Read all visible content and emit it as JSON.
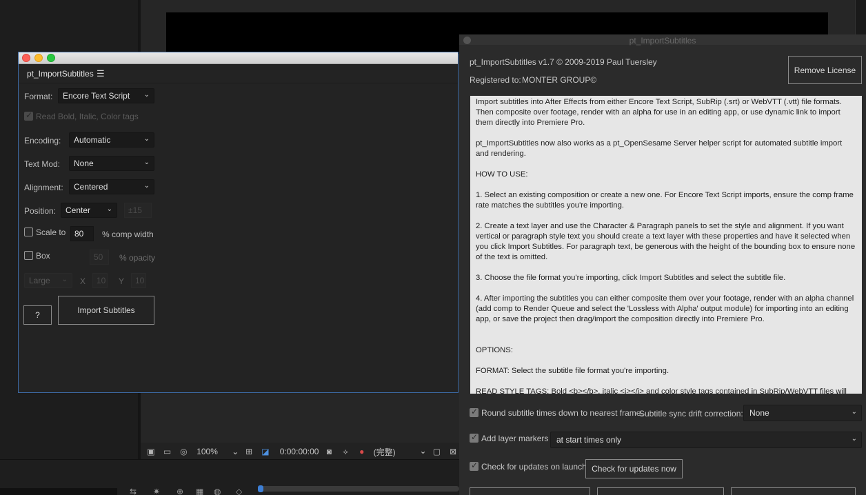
{
  "left_window": {
    "tab_label": "pt_ImportSubtitles",
    "format_label": "Format:",
    "format_value": "Encore Text Script",
    "read_tags_label": "Read Bold, Italic, Color tags",
    "encoding_label": "Encoding:",
    "encoding_value": "Automatic",
    "textmod_label": "Text Mod:",
    "textmod_value": "None",
    "alignment_label": "Alignment:",
    "alignment_value": "Centered",
    "position_label": "Position:",
    "position_value": "Center",
    "position_extra": "±15",
    "scale_label": "Scale to",
    "scale_value": "80",
    "scale_unit": "%  comp width",
    "box_label": "Box",
    "box_opacity_value": "50",
    "box_opacity_unit": "%  opacity",
    "size_value": "Large",
    "x_label": "X",
    "x_value": "10",
    "y_label": "Y",
    "y_value": "10",
    "help_button": "?",
    "import_button": "Import Subtitles"
  },
  "right_window": {
    "title": "pt_ImportSubtitles",
    "version_line": "pt_ImportSubtitles v1.7 © 2009-2019 Paul Tuersley",
    "registered_label": "Registered to:",
    "registered_value": "MONTER GROUP©",
    "remove_license_button": "Remove License",
    "help_paragraphs": [
      "Import subtitles into After Effects from either Encore Text Script, SubRip (.srt) or WebVTT (.vtt) file formats. Then composite over footage, render with an alpha for use in an editing app, or use dynamic link to import them directly into Premiere Pro.",
      "pt_ImportSubtitles now also works as a pt_OpenSesame Server helper script for automated subtitle import and rendering.",
      "HOW TO USE:",
      "1. Select an existing composition or create a new one. For Encore Text Script imports, ensure the comp frame rate matches the subtitles you're importing.",
      "2. Create a text layer and use the Character & Paragraph panels to set the style and alignment. If you want vertical or paragraph style text you should create a text layer with these properties and have it selected when you click Import Subtitles. For paragraph text, be generous with the height of the bounding box to ensure none of the text is omitted.",
      "3. Choose the file format you're importing, click Import Subtitles and select the subtitle file.",
      "4. After importing the subtitles you can either composite them over your footage, render with an alpha channel (add comp to Render Queue and select the 'Lossless with Alpha' output module) for importing into an editing app, or save the project then drag/import the composition directly into Premiere Pro.",
      "OPTIONS:",
      "FORMAT: Select the subtitle file format you're importing.",
      "READ STYLE TAGS: Bold <b></b>, italic <i></i> and color style tags contained in SubRip/WebVTT files will be"
    ],
    "round_label": "Round subtitle times down to nearest frame.",
    "drift_label": "Subtitle sync drift correction:",
    "drift_value": "None",
    "markers_label": "Add layer markers",
    "markers_value": "at start times only",
    "updates_label": "Check for updates on launch",
    "updates_button": "Check for updates now"
  },
  "viewer": {
    "zoom": "100%",
    "timecode": "0:00:00:00",
    "resolution": "(完整)"
  },
  "colors": {
    "window_border": "#3c6aa5",
    "timeline_head": "#3d7fd6",
    "help_bg": "#e6e6e6"
  }
}
